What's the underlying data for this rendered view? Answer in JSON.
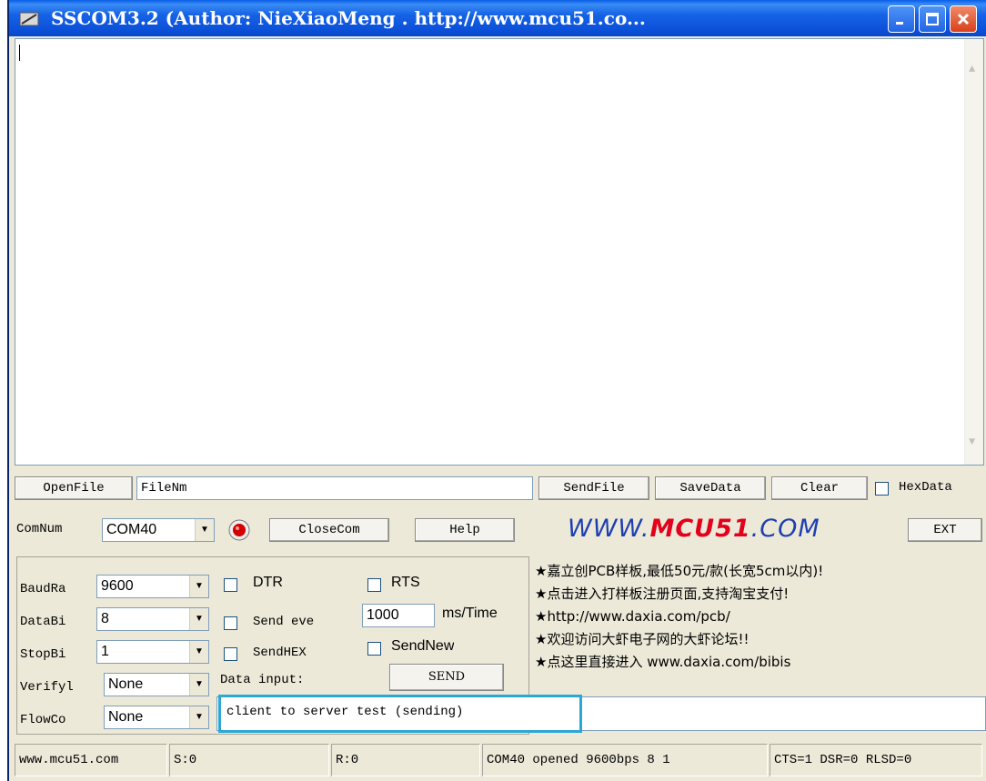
{
  "title": "SSCOM3.2 (Author: NieXiaoMeng .  http://www.mcu51.co...",
  "output_text": "",
  "file_row": {
    "open_file": "OpenFile",
    "file_name": "FileNm",
    "send_file": "SendFile",
    "save_data": "SaveData",
    "clear": "Clear",
    "hex_data": "HexData"
  },
  "com_row": {
    "com_num_label": "ComNum",
    "com_num_value": "COM40",
    "close_com": "CloseCom",
    "help": "Help",
    "brand_left": "WWW.",
    "brand_mid": "MCU51",
    "brand_right": ".COM",
    "ext": "EXT"
  },
  "settings": {
    "baud_label": "BaudRa",
    "baud_value": "9600",
    "data_bits_label": "DataBi",
    "data_bits_value": "8",
    "stop_bits_label": "StopBi",
    "stop_bits_value": "1",
    "verify_label": "Verifyl",
    "verify_value": "None",
    "flow_label": "FlowCo",
    "flow_value": "None"
  },
  "options": {
    "dtr": "DTR",
    "rts": "RTS",
    "send_every": "Send eve",
    "interval_value": "1000",
    "interval_unit": "ms/Time",
    "send_hex": "SendHEX",
    "send_new": "SendNew",
    "data_input_label": "Data input:",
    "send": "SEND",
    "data_input_value": "client to server test (sending)"
  },
  "ads": [
    "★嘉立创PCB样板,最低50元/款(长宽5cm以内)!",
    "★点击进入打样板注册页面,支持淘宝支付!",
    "★http://www.daxia.com/pcb/",
    "★欢迎访问大虾电子网的大虾论坛!!",
    "★点这里直接进入 www.daxia.com/bibis"
  ],
  "status": {
    "site": "www.mcu51.com",
    "sent": "S:0",
    "received": "R:0",
    "port_status": "COM40 opened 9600bps  8 1",
    "signals": "CTS=1 DSR=0 RLSD=0"
  },
  "colors": {
    "titlebar": "#0b4fd8",
    "highlight": "#2ba6d6",
    "brand_blue": "#1f3fb1",
    "brand_red": "#e3001b",
    "indicator": "#d40000"
  }
}
